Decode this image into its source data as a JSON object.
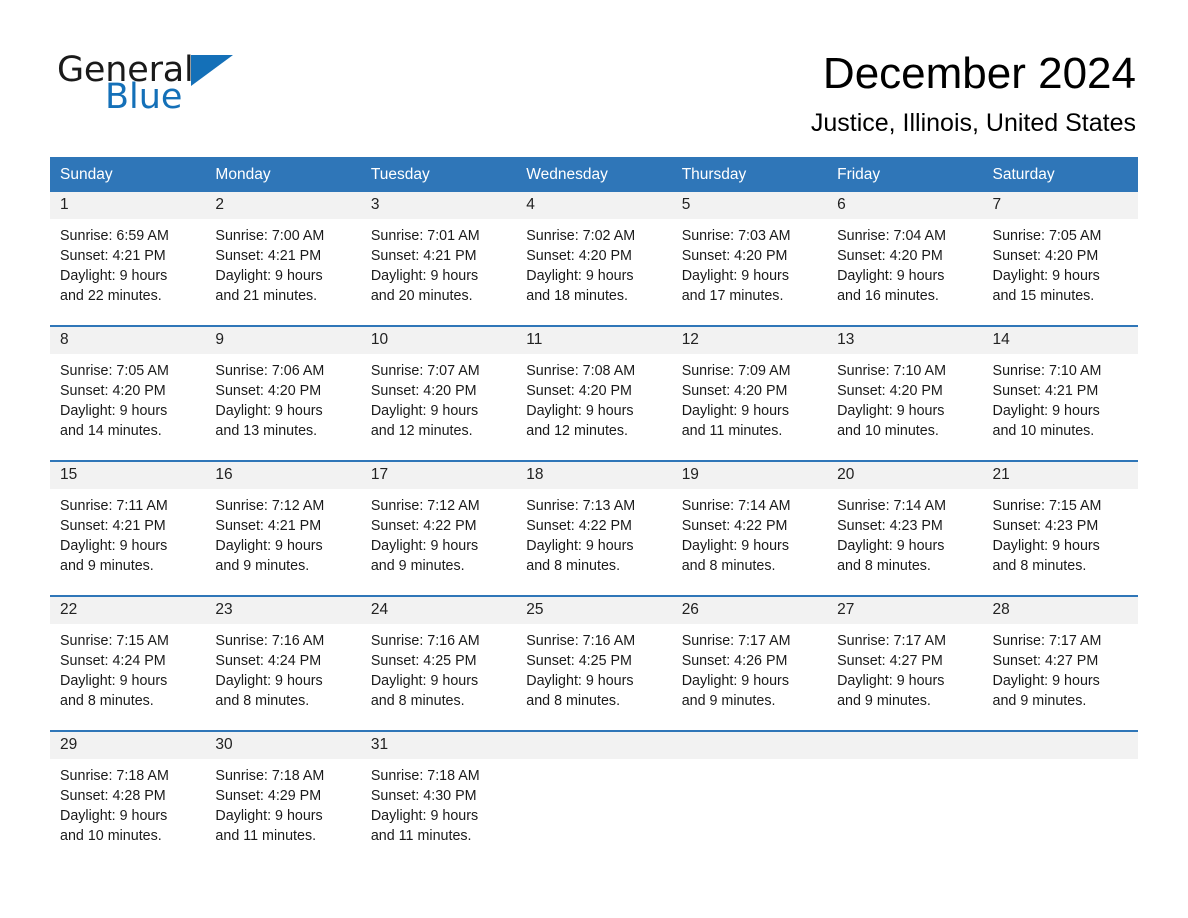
{
  "brand": {
    "name_part1": "General",
    "name_part2": "Blue",
    "triangle_color": "#1470b8",
    "accent_color": "#2f76b8"
  },
  "header": {
    "month_title": "December 2024",
    "location": "Justice, Illinois, United States"
  },
  "calendar": {
    "weekday_headers": [
      "Sunday",
      "Monday",
      "Tuesday",
      "Wednesday",
      "Thursday",
      "Friday",
      "Saturday"
    ],
    "header_bg": "#2f76b8",
    "daynum_bg": "#f2f2f2",
    "weeks": [
      [
        {
          "day": "1",
          "sunrise": "Sunrise: 6:59 AM",
          "sunset": "Sunset: 4:21 PM",
          "daylight_line1": "Daylight: 9 hours",
          "daylight_line2": "and 22 minutes."
        },
        {
          "day": "2",
          "sunrise": "Sunrise: 7:00 AM",
          "sunset": "Sunset: 4:21 PM",
          "daylight_line1": "Daylight: 9 hours",
          "daylight_line2": "and 21 minutes."
        },
        {
          "day": "3",
          "sunrise": "Sunrise: 7:01 AM",
          "sunset": "Sunset: 4:21 PM",
          "daylight_line1": "Daylight: 9 hours",
          "daylight_line2": "and 20 minutes."
        },
        {
          "day": "4",
          "sunrise": "Sunrise: 7:02 AM",
          "sunset": "Sunset: 4:20 PM",
          "daylight_line1": "Daylight: 9 hours",
          "daylight_line2": "and 18 minutes."
        },
        {
          "day": "5",
          "sunrise": "Sunrise: 7:03 AM",
          "sunset": "Sunset: 4:20 PM",
          "daylight_line1": "Daylight: 9 hours",
          "daylight_line2": "and 17 minutes."
        },
        {
          "day": "6",
          "sunrise": "Sunrise: 7:04 AM",
          "sunset": "Sunset: 4:20 PM",
          "daylight_line1": "Daylight: 9 hours",
          "daylight_line2": "and 16 minutes."
        },
        {
          "day": "7",
          "sunrise": "Sunrise: 7:05 AM",
          "sunset": "Sunset: 4:20 PM",
          "daylight_line1": "Daylight: 9 hours",
          "daylight_line2": "and 15 minutes."
        }
      ],
      [
        {
          "day": "8",
          "sunrise": "Sunrise: 7:05 AM",
          "sunset": "Sunset: 4:20 PM",
          "daylight_line1": "Daylight: 9 hours",
          "daylight_line2": "and 14 minutes."
        },
        {
          "day": "9",
          "sunrise": "Sunrise: 7:06 AM",
          "sunset": "Sunset: 4:20 PM",
          "daylight_line1": "Daylight: 9 hours",
          "daylight_line2": "and 13 minutes."
        },
        {
          "day": "10",
          "sunrise": "Sunrise: 7:07 AM",
          "sunset": "Sunset: 4:20 PM",
          "daylight_line1": "Daylight: 9 hours",
          "daylight_line2": "and 12 minutes."
        },
        {
          "day": "11",
          "sunrise": "Sunrise: 7:08 AM",
          "sunset": "Sunset: 4:20 PM",
          "daylight_line1": "Daylight: 9 hours",
          "daylight_line2": "and 12 minutes."
        },
        {
          "day": "12",
          "sunrise": "Sunrise: 7:09 AM",
          "sunset": "Sunset: 4:20 PM",
          "daylight_line1": "Daylight: 9 hours",
          "daylight_line2": "and 11 minutes."
        },
        {
          "day": "13",
          "sunrise": "Sunrise: 7:10 AM",
          "sunset": "Sunset: 4:20 PM",
          "daylight_line1": "Daylight: 9 hours",
          "daylight_line2": "and 10 minutes."
        },
        {
          "day": "14",
          "sunrise": "Sunrise: 7:10 AM",
          "sunset": "Sunset: 4:21 PM",
          "daylight_line1": "Daylight: 9 hours",
          "daylight_line2": "and 10 minutes."
        }
      ],
      [
        {
          "day": "15",
          "sunrise": "Sunrise: 7:11 AM",
          "sunset": "Sunset: 4:21 PM",
          "daylight_line1": "Daylight: 9 hours",
          "daylight_line2": "and 9 minutes."
        },
        {
          "day": "16",
          "sunrise": "Sunrise: 7:12 AM",
          "sunset": "Sunset: 4:21 PM",
          "daylight_line1": "Daylight: 9 hours",
          "daylight_line2": "and 9 minutes."
        },
        {
          "day": "17",
          "sunrise": "Sunrise: 7:12 AM",
          "sunset": "Sunset: 4:22 PM",
          "daylight_line1": "Daylight: 9 hours",
          "daylight_line2": "and 9 minutes."
        },
        {
          "day": "18",
          "sunrise": "Sunrise: 7:13 AM",
          "sunset": "Sunset: 4:22 PM",
          "daylight_line1": "Daylight: 9 hours",
          "daylight_line2": "and 8 minutes."
        },
        {
          "day": "19",
          "sunrise": "Sunrise: 7:14 AM",
          "sunset": "Sunset: 4:22 PM",
          "daylight_line1": "Daylight: 9 hours",
          "daylight_line2": "and 8 minutes."
        },
        {
          "day": "20",
          "sunrise": "Sunrise: 7:14 AM",
          "sunset": "Sunset: 4:23 PM",
          "daylight_line1": "Daylight: 9 hours",
          "daylight_line2": "and 8 minutes."
        },
        {
          "day": "21",
          "sunrise": "Sunrise: 7:15 AM",
          "sunset": "Sunset: 4:23 PM",
          "daylight_line1": "Daylight: 9 hours",
          "daylight_line2": "and 8 minutes."
        }
      ],
      [
        {
          "day": "22",
          "sunrise": "Sunrise: 7:15 AM",
          "sunset": "Sunset: 4:24 PM",
          "daylight_line1": "Daylight: 9 hours",
          "daylight_line2": "and 8 minutes."
        },
        {
          "day": "23",
          "sunrise": "Sunrise: 7:16 AM",
          "sunset": "Sunset: 4:24 PM",
          "daylight_line1": "Daylight: 9 hours",
          "daylight_line2": "and 8 minutes."
        },
        {
          "day": "24",
          "sunrise": "Sunrise: 7:16 AM",
          "sunset": "Sunset: 4:25 PM",
          "daylight_line1": "Daylight: 9 hours",
          "daylight_line2": "and 8 minutes."
        },
        {
          "day": "25",
          "sunrise": "Sunrise: 7:16 AM",
          "sunset": "Sunset: 4:25 PM",
          "daylight_line1": "Daylight: 9 hours",
          "daylight_line2": "and 8 minutes."
        },
        {
          "day": "26",
          "sunrise": "Sunrise: 7:17 AM",
          "sunset": "Sunset: 4:26 PM",
          "daylight_line1": "Daylight: 9 hours",
          "daylight_line2": "and 9 minutes."
        },
        {
          "day": "27",
          "sunrise": "Sunrise: 7:17 AM",
          "sunset": "Sunset: 4:27 PM",
          "daylight_line1": "Daylight: 9 hours",
          "daylight_line2": "and 9 minutes."
        },
        {
          "day": "28",
          "sunrise": "Sunrise: 7:17 AM",
          "sunset": "Sunset: 4:27 PM",
          "daylight_line1": "Daylight: 9 hours",
          "daylight_line2": "and 9 minutes."
        }
      ],
      [
        {
          "day": "29",
          "sunrise": "Sunrise: 7:18 AM",
          "sunset": "Sunset: 4:28 PM",
          "daylight_line1": "Daylight: 9 hours",
          "daylight_line2": "and 10 minutes."
        },
        {
          "day": "30",
          "sunrise": "Sunrise: 7:18 AM",
          "sunset": "Sunset: 4:29 PM",
          "daylight_line1": "Daylight: 9 hours",
          "daylight_line2": "and 11 minutes."
        },
        {
          "day": "31",
          "sunrise": "Sunrise: 7:18 AM",
          "sunset": "Sunset: 4:30 PM",
          "daylight_line1": "Daylight: 9 hours",
          "daylight_line2": "and 11 minutes."
        },
        {
          "day": "",
          "sunrise": "",
          "sunset": "",
          "daylight_line1": "",
          "daylight_line2": ""
        },
        {
          "day": "",
          "sunrise": "",
          "sunset": "",
          "daylight_line1": "",
          "daylight_line2": ""
        },
        {
          "day": "",
          "sunrise": "",
          "sunset": "",
          "daylight_line1": "",
          "daylight_line2": ""
        },
        {
          "day": "",
          "sunrise": "",
          "sunset": "",
          "daylight_line1": "",
          "daylight_line2": ""
        }
      ]
    ]
  }
}
